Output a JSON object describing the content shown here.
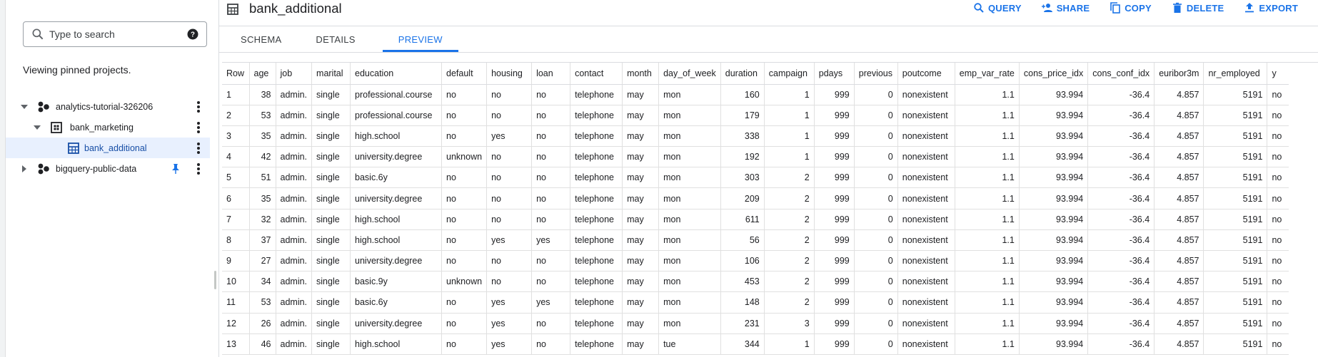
{
  "search": {
    "placeholder": "Type to search"
  },
  "pinned_text": "Viewing pinned projects.",
  "tree": [
    {
      "label": "analytics-tutorial-326206",
      "icon": "project-icon",
      "expanded": true
    },
    {
      "label": "bank_marketing",
      "icon": "dataset-icon",
      "expanded": true
    },
    {
      "label": "bank_additional",
      "icon": "table-icon",
      "selected": true
    },
    {
      "label": "bigquery-public-data",
      "icon": "project-icon",
      "expanded": false,
      "pinned": true
    }
  ],
  "header": {
    "title": "bank_additional",
    "actions": [
      {
        "label": "QUERY",
        "icon": "search-icon"
      },
      {
        "label": "SHARE",
        "icon": "person-add-icon"
      },
      {
        "label": "COPY",
        "icon": "copy-icon"
      },
      {
        "label": "DELETE",
        "icon": "trash-icon"
      },
      {
        "label": "EXPORT",
        "icon": "upload-icon"
      }
    ]
  },
  "tabs": [
    {
      "label": "SCHEMA",
      "active": false
    },
    {
      "label": "DETAILS",
      "active": false
    },
    {
      "label": "PREVIEW",
      "active": true
    }
  ],
  "colors": {
    "accent": "#1a73e8",
    "selected_bg": "#e8f0fe"
  },
  "table": {
    "columns": [
      "Row",
      "age",
      "job",
      "marital",
      "education",
      "default",
      "housing",
      "loan",
      "contact",
      "month",
      "day_of_week",
      "duration",
      "campaign",
      "pdays",
      "previous",
      "poutcome",
      "emp_var_rate",
      "cons_price_idx",
      "cons_conf_idx",
      "euribor3m",
      "nr_employed",
      "y"
    ],
    "numeric_cols": [
      1,
      11,
      12,
      13,
      14,
      16,
      17,
      18,
      19,
      20
    ],
    "rows": [
      [
        "1",
        "38",
        "admin.",
        "single",
        "professional.course",
        "no",
        "no",
        "no",
        "telephone",
        "may",
        "mon",
        "160",
        "1",
        "999",
        "0",
        "nonexistent",
        "1.1",
        "93.994",
        "-36.4",
        "4.857",
        "5191",
        "no"
      ],
      [
        "2",
        "53",
        "admin.",
        "single",
        "professional.course",
        "no",
        "no",
        "no",
        "telephone",
        "may",
        "mon",
        "179",
        "1",
        "999",
        "0",
        "nonexistent",
        "1.1",
        "93.994",
        "-36.4",
        "4.857",
        "5191",
        "no"
      ],
      [
        "3",
        "35",
        "admin.",
        "single",
        "high.school",
        "no",
        "yes",
        "no",
        "telephone",
        "may",
        "mon",
        "338",
        "1",
        "999",
        "0",
        "nonexistent",
        "1.1",
        "93.994",
        "-36.4",
        "4.857",
        "5191",
        "no"
      ],
      [
        "4",
        "42",
        "admin.",
        "single",
        "university.degree",
        "unknown",
        "no",
        "no",
        "telephone",
        "may",
        "mon",
        "192",
        "1",
        "999",
        "0",
        "nonexistent",
        "1.1",
        "93.994",
        "-36.4",
        "4.857",
        "5191",
        "no"
      ],
      [
        "5",
        "51",
        "admin.",
        "single",
        "basic.6y",
        "no",
        "no",
        "no",
        "telephone",
        "may",
        "mon",
        "303",
        "2",
        "999",
        "0",
        "nonexistent",
        "1.1",
        "93.994",
        "-36.4",
        "4.857",
        "5191",
        "no"
      ],
      [
        "6",
        "35",
        "admin.",
        "single",
        "university.degree",
        "no",
        "no",
        "no",
        "telephone",
        "may",
        "mon",
        "209",
        "2",
        "999",
        "0",
        "nonexistent",
        "1.1",
        "93.994",
        "-36.4",
        "4.857",
        "5191",
        "no"
      ],
      [
        "7",
        "32",
        "admin.",
        "single",
        "high.school",
        "no",
        "no",
        "no",
        "telephone",
        "may",
        "mon",
        "611",
        "2",
        "999",
        "0",
        "nonexistent",
        "1.1",
        "93.994",
        "-36.4",
        "4.857",
        "5191",
        "no"
      ],
      [
        "8",
        "37",
        "admin.",
        "single",
        "high.school",
        "no",
        "yes",
        "yes",
        "telephone",
        "may",
        "mon",
        "56",
        "2",
        "999",
        "0",
        "nonexistent",
        "1.1",
        "93.994",
        "-36.4",
        "4.857",
        "5191",
        "no"
      ],
      [
        "9",
        "27",
        "admin.",
        "single",
        "university.degree",
        "no",
        "no",
        "no",
        "telephone",
        "may",
        "mon",
        "106",
        "2",
        "999",
        "0",
        "nonexistent",
        "1.1",
        "93.994",
        "-36.4",
        "4.857",
        "5191",
        "no"
      ],
      [
        "10",
        "34",
        "admin.",
        "single",
        "basic.9y",
        "unknown",
        "no",
        "no",
        "telephone",
        "may",
        "mon",
        "453",
        "2",
        "999",
        "0",
        "nonexistent",
        "1.1",
        "93.994",
        "-36.4",
        "4.857",
        "5191",
        "no"
      ],
      [
        "11",
        "53",
        "admin.",
        "single",
        "basic.6y",
        "no",
        "yes",
        "yes",
        "telephone",
        "may",
        "mon",
        "148",
        "2",
        "999",
        "0",
        "nonexistent",
        "1.1",
        "93.994",
        "-36.4",
        "4.857",
        "5191",
        "no"
      ],
      [
        "12",
        "26",
        "admin.",
        "single",
        "university.degree",
        "no",
        "yes",
        "no",
        "telephone",
        "may",
        "mon",
        "231",
        "3",
        "999",
        "0",
        "nonexistent",
        "1.1",
        "93.994",
        "-36.4",
        "4.857",
        "5191",
        "no"
      ],
      [
        "13",
        "46",
        "admin.",
        "single",
        "high.school",
        "no",
        "yes",
        "no",
        "telephone",
        "may",
        "tue",
        "344",
        "1",
        "999",
        "0",
        "nonexistent",
        "1.1",
        "93.994",
        "-36.4",
        "4.857",
        "5191",
        "no"
      ]
    ]
  }
}
